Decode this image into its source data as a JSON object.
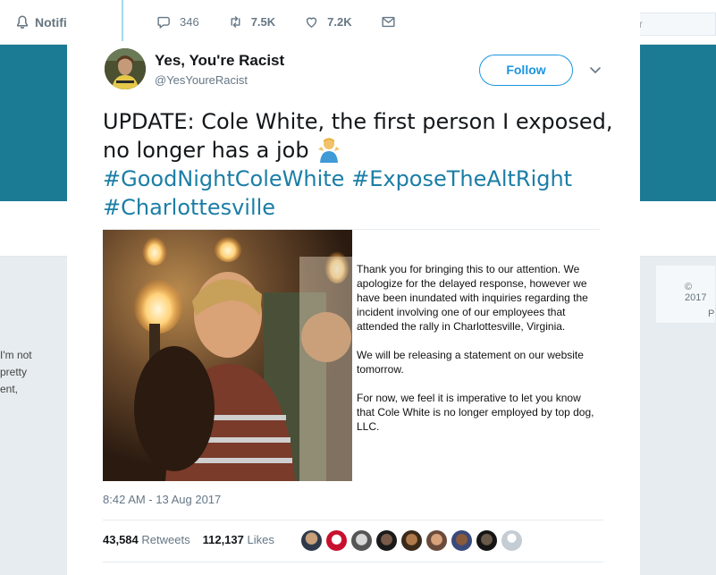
{
  "background": {
    "notifications_label": "Notifi",
    "search_fragment": "r",
    "left_card_lines": [
      "I'm not",
      "pretty",
      "ent,"
    ],
    "right_card_lines": [
      "© 2017",
      "P"
    ]
  },
  "previous_tweet_actions": {
    "replies": "346",
    "retweets": "7.5K",
    "likes": "7.2K"
  },
  "tweet": {
    "author_name": "Yes, You're Racist",
    "author_handle": "@YesYoureRacist",
    "follow_label": "Follow",
    "text": "UPDATE: Cole White, the first person I exposed, no longer has a job",
    "hashtags": [
      "#GoodNightColeWhite",
      "#ExposeTheAltRight",
      "#Charlottesville"
    ],
    "timestamp": "8:42 AM - 13 Aug 2017",
    "retweets_count": "43,584",
    "retweets_label": "Retweets",
    "likes_count": "112,137",
    "likes_label": "Likes"
  },
  "attached_statement": {
    "paragraphs": [
      "Thank you for bringing this to our attention. We apologize for the delayed response, however we have been inundated with inquiries regarding the incident involving one of our employees that attended the rally in Charlottesville, Virginia.",
      "We will be releasing a statement on our website tomorrow.",
      "For now, we feel it is imperative to let you know that Cole White is no longer employed by top dog, LLC."
    ]
  },
  "colors": {
    "banner": "#1b7a94",
    "link": "#1b7ea6",
    "follow": "#1b95e0",
    "muted": "#657786"
  },
  "icons": [
    "bell-icon",
    "reply-icon",
    "retweet-icon",
    "heart-icon",
    "mail-icon",
    "chevron-down-icon",
    "shrug-emoji-icon"
  ]
}
